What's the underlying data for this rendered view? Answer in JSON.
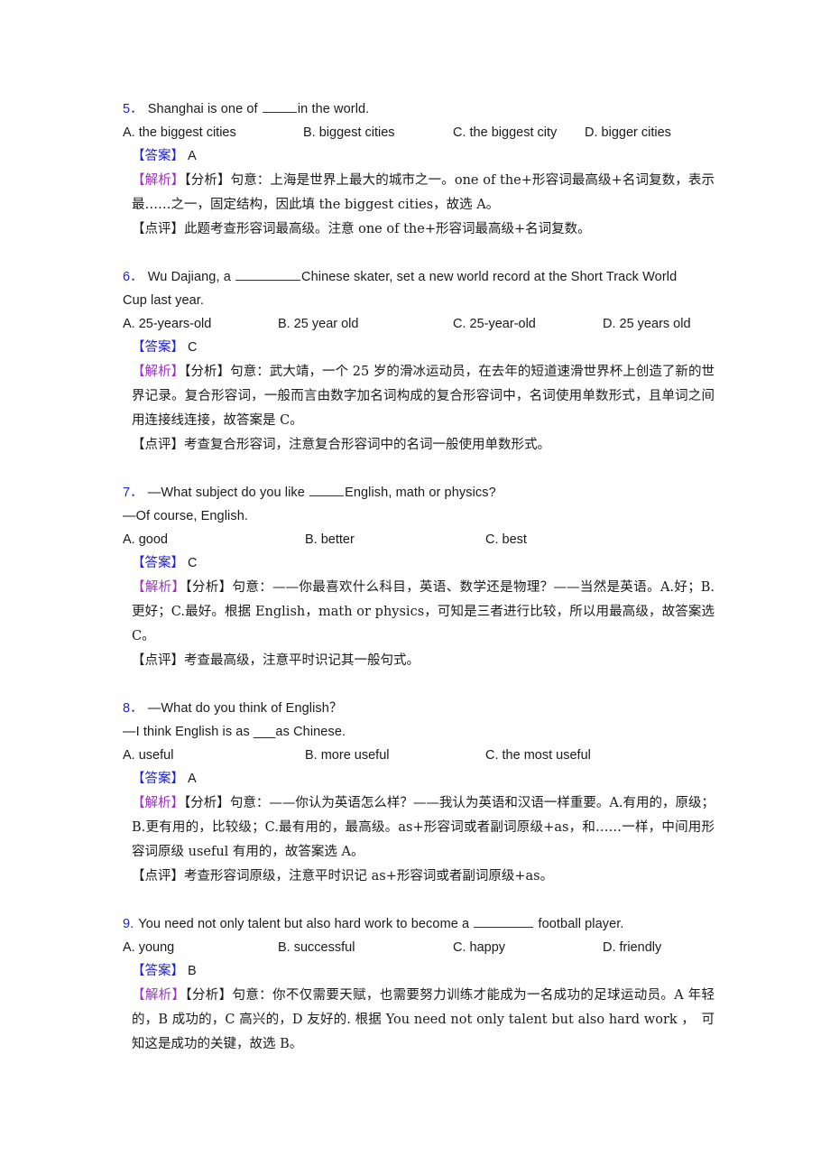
{
  "document": {
    "type": "english-grammar-exercise-answer-key",
    "accent_color": "#2222cc",
    "analysis_marker_color": "#9933bb",
    "text_color": "#1a1a1a",
    "background_color": "#ffffff"
  },
  "labels": {
    "answer": "【答案】",
    "analysis_open": "【解析】",
    "analysis_sub": "【分析】",
    "comment": "【点评】"
  },
  "questions": [
    {
      "number": "5．",
      "stem_part1": "Shanghai is one of ",
      "blank": "w-md",
      "stem_part2": "in the world.",
      "stem_line2": "",
      "option_layout": "cols4",
      "options": [
        "A. the biggest cities",
        "B. biggest cities",
        "C. the biggest city",
        "D. bigger cities"
      ],
      "answer": "A",
      "analysis": "句意：上海是世界上最大的城市之一。one of the+形容词最高级+名词复数，表示最……之一，固定结构，因此填 the biggest cities，故选 A。",
      "comment": "此题考查形容词最高级。注意 one of the+形容词最高级+名词复数。"
    },
    {
      "number": "6．",
      "stem_part1": "Wu Dajiang, a ",
      "blank": "w-xl",
      "stem_part2": "Chinese skater, set a new world record at the Short Track World",
      "stem_line2": "Cup last year.",
      "option_layout": "cols4b",
      "options": [
        "A. 25-years-old",
        "B. 25 year old",
        "C. 25-year-old",
        "D. 25 years old"
      ],
      "answer": "C",
      "analysis": "句意：武大靖，一个 25 岁的滑冰运动员，在去年的短道速滑世界杯上创造了新的世界记录。复合形容词，一般而言由数字加名词构成的复合形容词中，名词使用单数形式，且单词之间用连接线连接，故答案是 C。",
      "comment": "考查复合形容词，注意复合形容词中的名词一般使用单数形式。"
    },
    {
      "number": "7．",
      "stem_part1": "—What subject do you like ",
      "blank": "w-md",
      "stem_part2": "English, math or physics?",
      "stem_line2": "—Of course, English.",
      "option_layout": "cols3",
      "options": [
        "A. good",
        "B. better",
        "C. best"
      ],
      "answer": "C",
      "analysis": "句意：——你最喜欢什么科目，英语、数学还是物理？——当然是英语。A.好；B.更好；C.最好。根据 English，math or physics，可知是三者进行比较，所以用最高级，故答案选 C。",
      "comment": "考查最高级，注意平时识记其一般句式。"
    },
    {
      "number": "8．",
      "stem_part1": "—What do you think of English？",
      "blank": "",
      "stem_part2": "",
      "stem_line2": "—I think English is as ___as Chinese.",
      "option_layout": "cols3",
      "options": [
        "A. useful",
        "B. more useful",
        "C. the most useful"
      ],
      "answer": "A",
      "analysis": "句意：——你认为英语怎么样？——我认为英语和汉语一样重要。A.有用的，原级；B.更有用的，比较级；C.最有用的，最高级。as+形容词或者副词原级+as，和……一样，中间用形容词原级 useful 有用的，故答案选 A。",
      "comment": "考查形容词原级，注意平时识记 as+形容词或者副词原级+as。"
    },
    {
      "number": "9.",
      "stem_part1": "You need not only talent but also hard work to become a ",
      "blank": "w-lg",
      "stem_part2": " football player.",
      "stem_line2": "",
      "option_layout": "cols4b",
      "options": [
        "A. young",
        "B. successful",
        "C. happy",
        "D. friendly"
      ],
      "answer": "B",
      "analysis": "句意：你不仅需要天赋，也需要努力训练才能成为一名成功的足球运动员。A 年轻的，B 成功的，C 高兴的，D 友好的. 根据 You need not only talent but also hard work ，　可知这是成功的关键，故选 B。",
      "comment": ""
    }
  ]
}
